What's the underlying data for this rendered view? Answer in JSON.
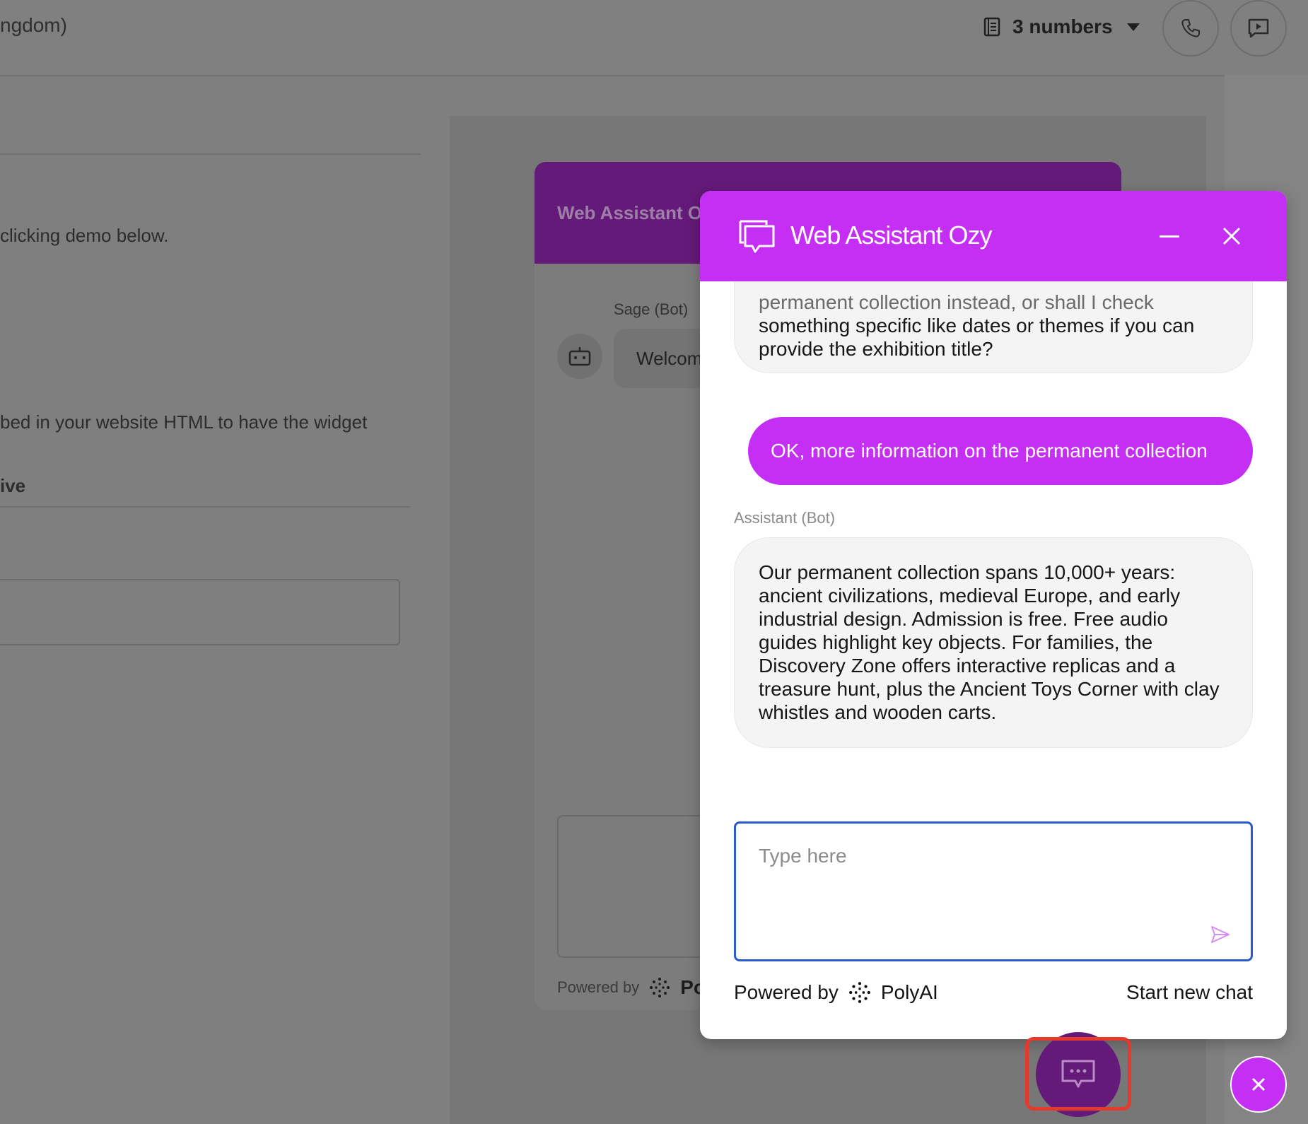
{
  "topbar": {
    "region_text": "ngdom)",
    "numbers_label": "3 numbers",
    "icons": [
      "book-icon",
      "caret-down-icon",
      "phone-icon",
      "chat-play-icon"
    ]
  },
  "background_page": {
    "demo_text": "clicking demo below.",
    "embed_text": "bed in your website HTML to have the widget",
    "live_label": "ive"
  },
  "preview_widget": {
    "title": "Web Assistant O",
    "sender": "Sage (Bot)",
    "message": "Welcom",
    "powered_by": "Powered by",
    "brand": "Po"
  },
  "chat": {
    "title": "Web Assistant Ozy",
    "messages": [
      {
        "role": "bot",
        "cut_line": "permanent collection instead, or shall I check",
        "text": "something specific like dates or themes if you can provide the exhibition title?"
      },
      {
        "role": "user",
        "text": "OK, more information on the permanent collection"
      },
      {
        "role": "bot",
        "label": "Assistant (Bot)",
        "text": "Our permanent collection spans 10,000+ years: ancient civilizations, medieval Europe, and early industrial design. Admission is free. Free audio guides highlight key objects. For families, the Discovery Zone offers interactive replicas and a treasure hunt, plus the Ancient Toys Corner with clay whistles and wooden carts."
      }
    ],
    "input_placeholder": "Type here",
    "powered_by": "Powered by",
    "brand": "PolyAI",
    "start_new_chat": "Start new chat"
  },
  "colors": {
    "accent": "#c52ff3",
    "launcher": "#641a79",
    "input_border": "#2a5bcd",
    "highlight": "#e5392b"
  }
}
